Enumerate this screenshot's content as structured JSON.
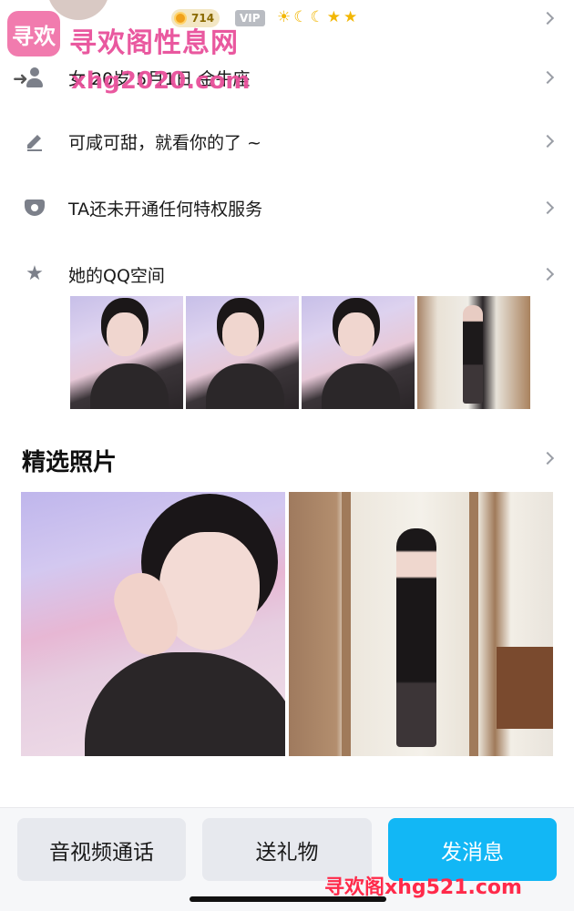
{
  "header": {
    "coin_count": "714",
    "vip_label": "VIP",
    "level_icons": [
      "sun",
      "moon",
      "moon",
      "star",
      "star"
    ]
  },
  "watermark": {
    "logo_text": "寻欢",
    "site_name": "寻欢阁性息网",
    "domain_top": "xhg2020.com",
    "domain_bottom": "寻欢阁xhg521.com"
  },
  "info_rows": [
    {
      "icon": "person-icon",
      "text": "女 20岁 5月1日 金牛座"
    },
    {
      "icon": "pencil-icon",
      "text": "可咸可甜，就看你的了 ~"
    },
    {
      "icon": "crown-shield-icon",
      "text": "TA还未开通任何特权服务"
    },
    {
      "icon": "qzone-star-icon",
      "text": "她的QQ空间"
    }
  ],
  "featured": {
    "title": "精选照片"
  },
  "actions": {
    "call_label": "音视频通话",
    "gift_label": "送礼物",
    "message_label": "发消息"
  },
  "colors": {
    "accent_blue": "#12b7f5",
    "watermark_pink": "#e8509a",
    "watermark_red": "#ff2a4a"
  }
}
